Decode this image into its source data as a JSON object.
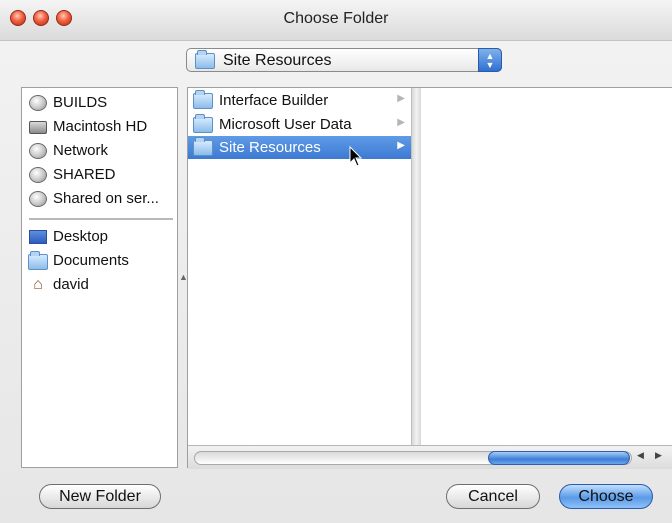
{
  "window": {
    "title": "Choose Folder"
  },
  "location_popup": {
    "selected": "Site Resources"
  },
  "sidebar": {
    "devices": [
      {
        "label": "BUILDS",
        "icon": "network-volume-icon"
      },
      {
        "label": "Macintosh HD",
        "icon": "hard-drive-icon"
      },
      {
        "label": "Network",
        "icon": "network-globe-icon"
      },
      {
        "label": "SHARED",
        "icon": "network-volume-icon"
      },
      {
        "label": "Shared on ser...",
        "icon": "network-volume-icon"
      }
    ],
    "places": [
      {
        "label": "Desktop",
        "icon": "desktop-icon"
      },
      {
        "label": "Documents",
        "icon": "folder-icon"
      },
      {
        "label": "david",
        "icon": "home-icon"
      }
    ]
  },
  "browser": {
    "column1": [
      {
        "label": "Interface Builder",
        "selected": false
      },
      {
        "label": "Microsoft User Data",
        "selected": false
      },
      {
        "label": "Site Resources",
        "selected": true
      }
    ]
  },
  "buttons": {
    "new_folder": "New Folder",
    "cancel": "Cancel",
    "choose": "Choose"
  },
  "colors": {
    "selection": "#3d79d2",
    "default_button": "#5a9ae8",
    "close": "#f0603f"
  }
}
